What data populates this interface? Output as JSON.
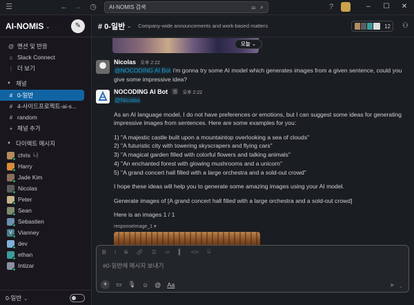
{
  "search": {
    "query": "AI-NOMIS 검색"
  },
  "workspace": {
    "name": "AI-NOMIS"
  },
  "sidebar": {
    "nav": [
      {
        "label": "멘션 및 반응",
        "icon": "at-icon"
      },
      {
        "label": "Slack Connect",
        "icon": "connect-icon"
      },
      {
        "label": "더 보기",
        "icon": "more-icon"
      }
    ],
    "channels_header": "채널",
    "channels": [
      {
        "label": "0-일반",
        "active": true
      },
      {
        "label": "4-사이드프로젝트-ai-s..."
      },
      {
        "label": "random"
      }
    ],
    "add_channel": "채널 추가",
    "dm_header": "다이렉트 메시지",
    "dms": [
      {
        "label": "chris",
        "suffix": "나",
        "color": "#b38b5d"
      },
      {
        "label": "Harry",
        "color": "#d98b3a"
      },
      {
        "label": "Jade Kim",
        "color": "#8a6d5b"
      },
      {
        "label": "Nicolas",
        "color": "#5c5c5c"
      },
      {
        "label": "Peter",
        "color": "#c5b58a"
      },
      {
        "label": "Sean",
        "color": "#7d8c6e"
      },
      {
        "label": "Sebastien",
        "color": "#6a8fb0"
      },
      {
        "label": "Vianney",
        "initial": "V",
        "color": "#4a7d8c"
      },
      {
        "label": "dev",
        "color": "#7fb0d8"
      },
      {
        "label": "ethan",
        "color": "#3c9b9b"
      },
      {
        "label": "Intizar",
        "color": "#8a8fa0"
      }
    ],
    "footer": "0-일반"
  },
  "channel": {
    "name": "# 0-일반",
    "topic": "Company-wide announcements and work-based matters",
    "member_count": "12",
    "date_pill": "오늘"
  },
  "messages": [
    {
      "sender": "Nicolas",
      "time": "오후 2:22",
      "mention": "@NOCODING AI Bot",
      "text": " i'm gonna try some AI model which generates images from a given sentence, could you give some impressive idea?"
    },
    {
      "sender": "NOCODING AI Bot",
      "app_badge": "앱",
      "time": "오후 2:22",
      "mention": "@Nicolas",
      "intro": "As an AI language model, I do not have preferences or emotions, but I can suggest some ideas for generating impressive images from sentences. Here are some examples for you:",
      "ideas": [
        "1) \"A majestic castle built upon a mountaintop overlooking a sea of clouds\"",
        "2) \"A futuristic city with towering skyscrapers and flying cars\"",
        "3) \"A magical garden filled with colorful flowers and talking animals\"",
        "4) \"An enchanted forest with glowing mushrooms and a unicorn\"",
        "5) \"A grand concert hall filled with a large orchestra and a sold-out crowd\""
      ],
      "hope": "I hope these ideas will help you to generate some amazing images using your AI model.",
      "generate": "Generate images of [A grand concert hall filled with a large orchestra and a sold-out crowd]",
      "count": "Here is an images 1 / 1",
      "attachment": "responseImage_1"
    }
  ],
  "composer": {
    "placeholder": "#0-일반에 메시지 보내기",
    "format_icons": [
      "B",
      "I",
      "S",
      "link",
      "ol",
      "ul",
      "quote",
      "code",
      "codeblock"
    ]
  }
}
